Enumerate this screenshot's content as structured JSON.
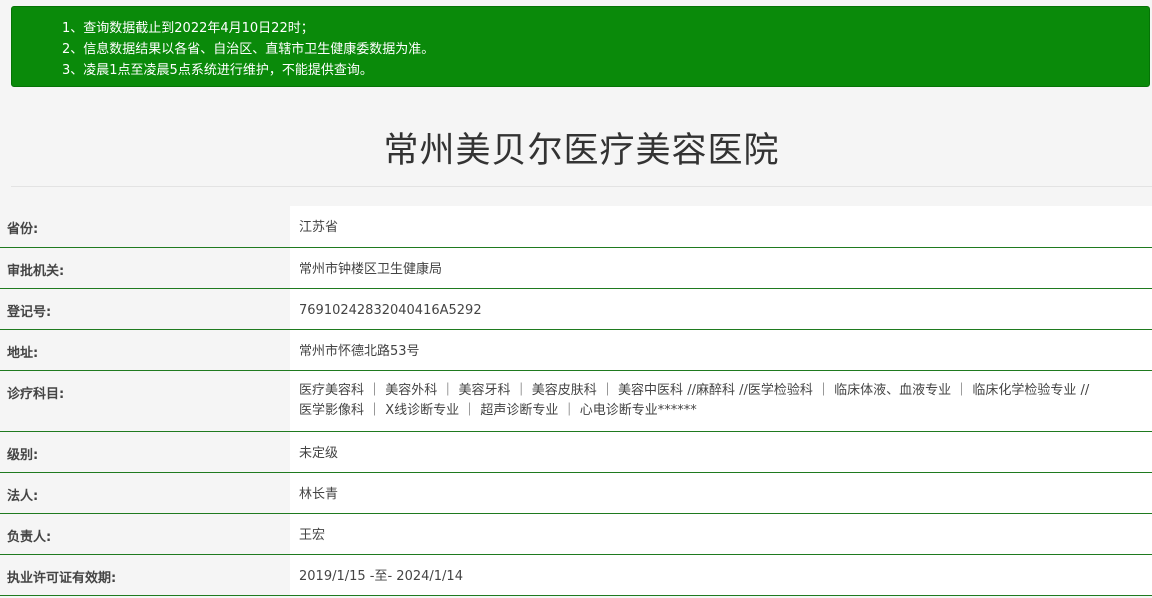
{
  "notice": {
    "lines": [
      "1、查询数据截止到2022年4月10日22时；",
      "2、信息数据结果以各省、自治区、直辖市卫生健康委数据为准。",
      "3、凌晨1点至凌晨5点系统进行维护，不能提供查询。"
    ],
    "background_color": "#0a8a0a"
  },
  "page": {
    "title": "常州美贝尔医疗美容医院"
  },
  "info": {
    "province_label": "省份:",
    "province_value": "江苏省",
    "authority_label": "审批机关:",
    "authority_value": "常州市钟楼区卫生健康局",
    "registration_label": "登记号:",
    "registration_value": "76910242832040416A5292",
    "address_label": "地址:",
    "address_value": "常州市怀德北路53号",
    "departments_label": "诊疗科目:",
    "departments_line1": "医疗美容科 ｜ 美容外科 ｜ 美容牙科 ｜ 美容皮肤科 ｜ 美容中医科 //麻醉科 //医学检验科 ｜ 临床体液、血液专业 ｜ 临床化学检验专业 //",
    "departments_line2": "医学影像科 ｜ X线诊断专业 ｜ 超声诊断专业 ｜ 心电诊断专业******",
    "level_label": "级别:",
    "level_value": "未定级",
    "legal_person_label": "法人:",
    "legal_person_value": "林长青",
    "principal_label": "负责人:",
    "principal_value": "王宏",
    "license_label": "执业许可证有效期:",
    "license_value": "2019/1/15 -至- 2024/1/14"
  },
  "colors": {
    "row_border": "#1f7a1f",
    "label_background": "#f5f5f5",
    "value_background": "#ffffff"
  }
}
